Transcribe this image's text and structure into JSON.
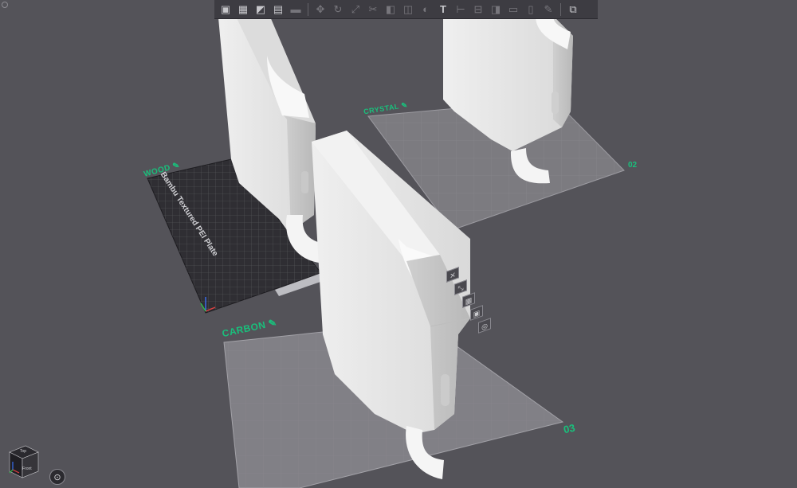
{
  "toolbar": {
    "tools": [
      {
        "icon": "add-object-icon"
      },
      {
        "icon": "grid-arrange-icon"
      },
      {
        "icon": "orient-icon"
      },
      {
        "icon": "plate-layout-icon"
      },
      {
        "icon": "split-icon",
        "disabled": true
      },
      {
        "icon": "move-icon",
        "disabled": true
      },
      {
        "icon": "rotate-icon",
        "disabled": true
      },
      {
        "icon": "scale-icon",
        "disabled": true
      },
      {
        "icon": "cut-icon",
        "disabled": true
      },
      {
        "icon": "support-paint-icon",
        "disabled": true
      },
      {
        "icon": "seam-paint-icon",
        "disabled": true
      },
      {
        "icon": "color-paint-icon",
        "disabled": true
      },
      {
        "icon": "text-icon",
        "glyph": "T"
      },
      {
        "icon": "measure-icon",
        "disabled": true
      },
      {
        "icon": "assembly-icon",
        "disabled": true
      },
      {
        "icon": "boolean-icon",
        "disabled": true
      },
      {
        "icon": "lock-icon",
        "disabled": true
      },
      {
        "icon": "variable-layer-icon",
        "disabled": true
      },
      {
        "icon": "edit-icon",
        "disabled": true
      },
      {
        "icon": "assembly-view-icon"
      }
    ]
  },
  "plates": [
    {
      "label": "WOOD",
      "plate_type": "Bambu Textured PEI Plate",
      "number": ""
    },
    {
      "label": "CRYSTAL",
      "number": "02"
    },
    {
      "label": "CARBON",
      "number": "03"
    }
  ],
  "plate_tools": [
    "close-plate-icon",
    "auto-orient-icon",
    "arrange-icon",
    "lock-plate-icon",
    "settings-icon"
  ],
  "navcube": {
    "top_face": "Top",
    "front_face": "Front"
  },
  "colors": {
    "accent": "#19c07c",
    "background": "#545359",
    "toolbar": "#3d3c42"
  }
}
